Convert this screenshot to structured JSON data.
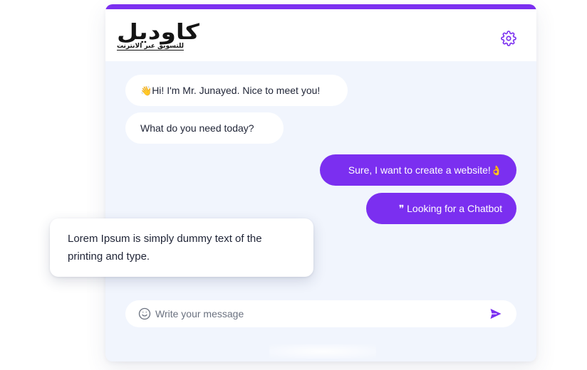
{
  "app": {
    "logo_text": "كاوديل",
    "logo_tagline": "للتسويق عبر الانترنت",
    "accent_color": "#7b2ff0"
  },
  "header": {
    "settings_icon": "gear-icon"
  },
  "messages": [
    {
      "sender": "bot",
      "emoji": "👋",
      "text": "Hi! I'm Mr. Junayed. Nice to meet you!"
    },
    {
      "sender": "bot",
      "text": "What do you need today?"
    },
    {
      "sender": "user",
      "text": "Sure, I want to create a website!",
      "emoji": "👌"
    },
    {
      "sender": "user",
      "emoji": "❞",
      "text": "Looking for a Chatbot"
    }
  ],
  "floating_card": {
    "text": "Lorem Ipsum is simply dummy text of the printing and type."
  },
  "composer": {
    "placeholder": "Write your message",
    "value": "",
    "emoji_icon": "smiley-icon",
    "send_icon": "send-icon"
  }
}
